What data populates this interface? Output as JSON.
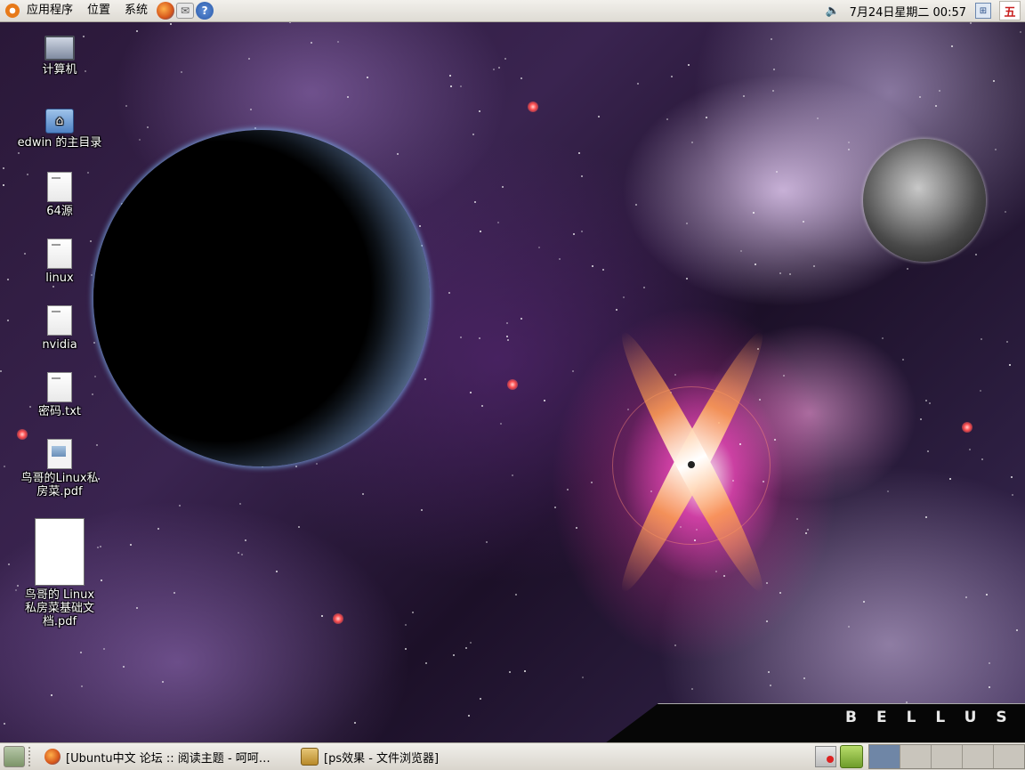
{
  "top_panel": {
    "menus": [
      "应用程序",
      "位置",
      "系统"
    ],
    "launchers": [
      "firefox-icon",
      "mail-icon",
      "help-icon"
    ],
    "clock": "7月24日星期二  00:57",
    "ime_label": "五"
  },
  "desktop": {
    "icons": [
      {
        "label": "计算机",
        "icon": "computer-icon"
      },
      {
        "label": "edwin 的主目录",
        "icon": "home-folder-icon"
      },
      {
        "label": "64源",
        "icon": "text-file-icon"
      },
      {
        "label": "linux",
        "icon": "text-file-icon"
      },
      {
        "label": "nvidia",
        "icon": "text-file-icon"
      },
      {
        "label": "密码.txt",
        "icon": "text-file-icon"
      },
      {
        "label": "鸟哥的Linux私房菜.pdf",
        "icon": "image-file-icon"
      },
      {
        "label": "鸟哥的 Linux 私房菜基础文档.pdf",
        "icon": "pdf-thumbnail-icon"
      }
    ],
    "wallpaper_brand": "BELLUS"
  },
  "bottom_panel": {
    "tasks": [
      {
        "label": "[Ubuntu中文 论坛 :: 阅读主题 - 呵呵…",
        "icon": "firefox-icon"
      },
      {
        "label": "[ps效果 - 文件浏览器]",
        "icon": "file-browser-icon"
      }
    ],
    "workspaces": 5,
    "active_workspace": 1
  },
  "colors": {
    "panel_bg": "#e4e1da",
    "ubuntu_orange": "#e77a1a",
    "active_workspace": "#6f86a6"
  }
}
